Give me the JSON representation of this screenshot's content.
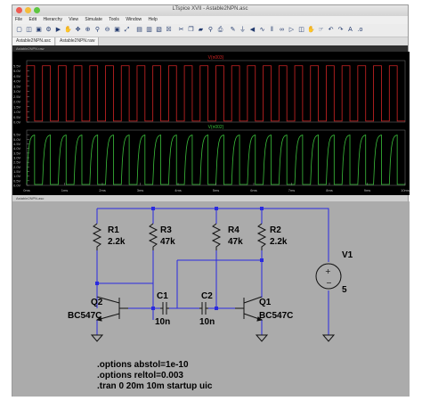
{
  "window": {
    "title": "LTspice XVII - Astable2NPN.asc"
  },
  "menu": [
    "File",
    "Edit",
    "Hierarchy",
    "View",
    "Simulate",
    "Tools",
    "Window",
    "Help"
  ],
  "tabs": [
    "Astable2NPN.asc",
    "Astable2NPN.raw"
  ],
  "panes": {
    "waveform_title": "Astable2NPN.raw",
    "schematic_title": "Astable2NPN.asc"
  },
  "colors": {
    "trace_top": "#d02525",
    "trace_bottom": "#3bbf3b",
    "wire": "#2a2ae0",
    "component": "#111111"
  },
  "chart_data": [
    {
      "type": "line",
      "series": [
        {
          "name": "V(n003)",
          "color": "#d02525"
        }
      ],
      "x_unit": "ms",
      "xlim": [
        0,
        10
      ],
      "y_unit": "V",
      "ylim": [
        0,
        6
      ],
      "yticks": [
        "5.5V",
        "5.0V",
        "4.5V",
        "4.0V",
        "3.5V",
        "3.0V",
        "2.5V",
        "2.0V",
        "1.5V",
        "1.0V",
        "0.5V",
        "0.0V"
      ],
      "signal": {
        "kind": "square",
        "high": 5.5,
        "low": 0.1,
        "cycles": 24
      }
    },
    {
      "type": "line",
      "series": [
        {
          "name": "V(n002)",
          "color": "#3bbf3b"
        }
      ],
      "x_unit": "ms",
      "xlim": [
        0,
        10
      ],
      "y_unit": "V",
      "ylim": [
        0,
        6
      ],
      "yticks": [
        "5.5V",
        "5.0V",
        "4.5V",
        "4.0V",
        "3.5V",
        "3.0V",
        "2.5V",
        "2.0V",
        "1.5V",
        "1.0V",
        "0.5V",
        "0.0V"
      ],
      "xticks": [
        "0ms",
        "1ms",
        "2ms",
        "3ms",
        "4ms",
        "5ms",
        "6ms",
        "7ms",
        "8ms",
        "9ms",
        "10ms"
      ],
      "signal": {
        "kind": "rc-square",
        "high": 5.5,
        "low": 0.1,
        "cycles": 24
      }
    }
  ],
  "schematic": {
    "components": [
      {
        "ref": "R1",
        "value": "2.2k"
      },
      {
        "ref": "R3",
        "value": "47k"
      },
      {
        "ref": "R4",
        "value": "47k"
      },
      {
        "ref": "R2",
        "value": "2.2k"
      },
      {
        "ref": "C1",
        "value": "10n"
      },
      {
        "ref": "C2",
        "value": "10n"
      },
      {
        "ref": "Q2",
        "value": "BC547C"
      },
      {
        "ref": "Q1",
        "value": "BC547C"
      },
      {
        "ref": "V1",
        "value": "5"
      }
    ],
    "directives": [
      ".options abstol=1e-10",
      ".options reltol=0.003",
      ".tran 0 20m 10m startup uic"
    ]
  }
}
